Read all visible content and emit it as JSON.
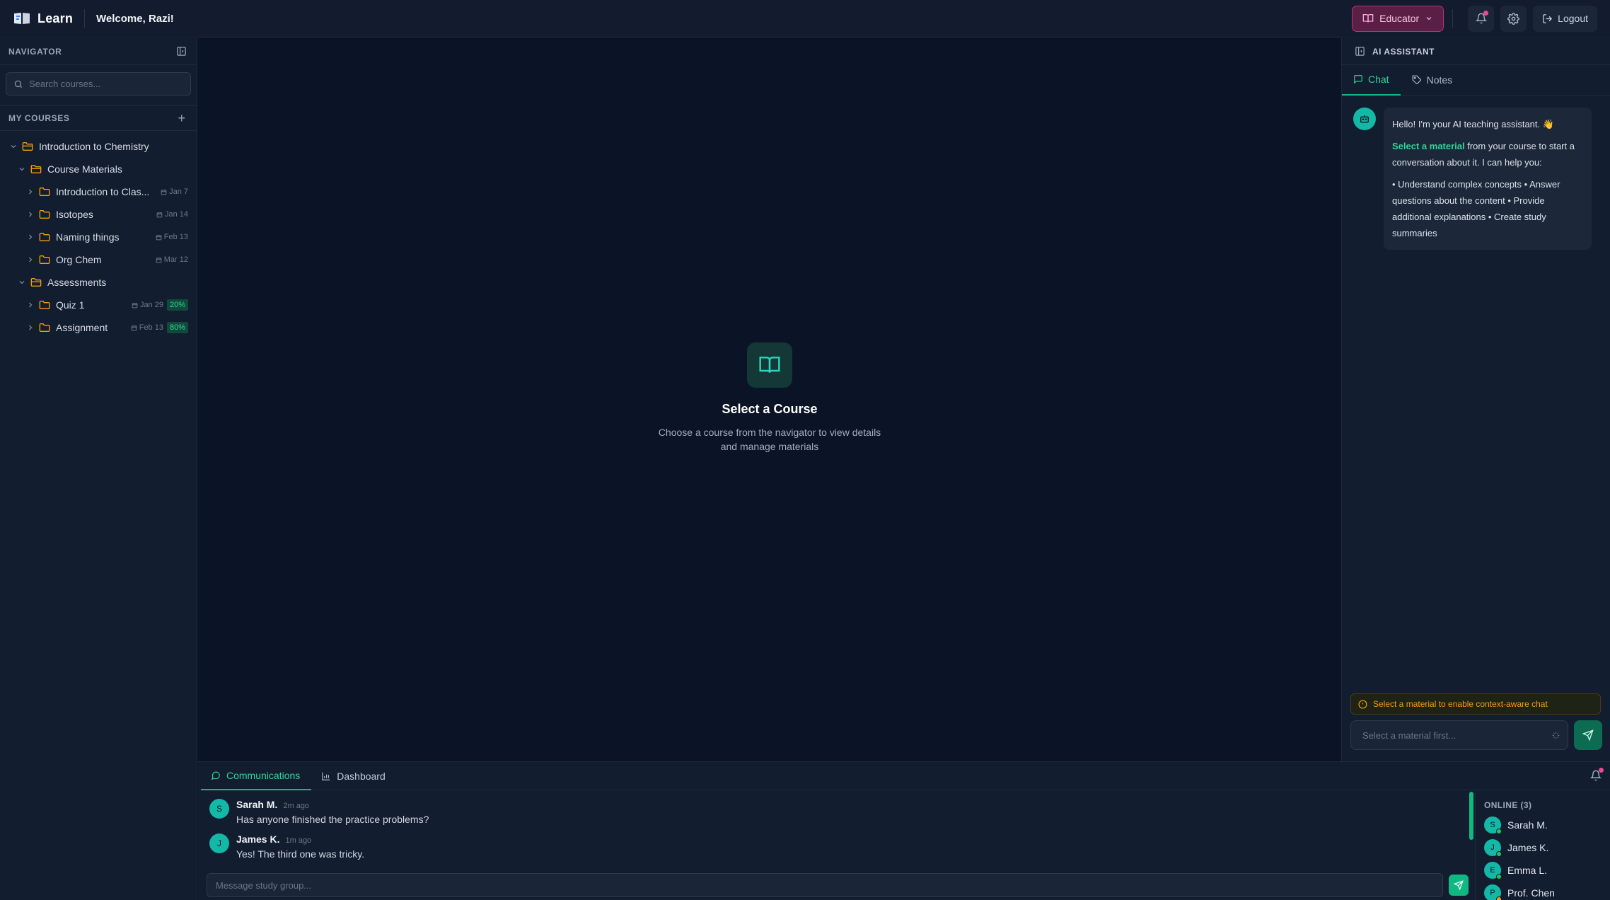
{
  "header": {
    "brand": "Learn",
    "welcome": "Welcome, Razi!",
    "role_label": "Educator",
    "logout_label": "Logout"
  },
  "navigator": {
    "title": "NAVIGATOR",
    "search_placeholder": "Search courses...",
    "my_courses_title": "MY COURSES",
    "course": "Introduction to Chemistry",
    "materials_folder": "Course Materials",
    "materials": [
      {
        "label": "Introduction to Clas...",
        "date": "Jan 7"
      },
      {
        "label": "Isotopes",
        "date": "Jan 14"
      },
      {
        "label": "Naming things",
        "date": "Feb 13"
      },
      {
        "label": "Org Chem",
        "date": "Mar 12"
      }
    ],
    "assessments_folder": "Assessments",
    "assessments": [
      {
        "label": "Quiz 1",
        "date": "Jan 29",
        "badge": "20%"
      },
      {
        "label": "Assignment",
        "date": "Feb 13",
        "badge": "80%"
      }
    ]
  },
  "main": {
    "empty_title": "Select a Course",
    "empty_text": "Choose a course from the navigator to view details and manage materials"
  },
  "assistant": {
    "title": "AI ASSISTANT",
    "tabs": [
      "Chat",
      "Notes"
    ],
    "greeting": "Hello! I'm your AI teaching assistant. 👋",
    "highlight": "Select a material",
    "intro_rest": " from your course to start a conversation about it. I can help you:",
    "capabilities": "• Understand complex concepts • Answer questions about the content • Provide additional explanations • Create study summaries",
    "warning": "Select a material to enable context-aware chat",
    "input_placeholder": "Select a material first..."
  },
  "comms": {
    "tabs": [
      "Communications",
      "Dashboard"
    ],
    "messages": [
      {
        "initial": "S",
        "author": "Sarah M.",
        "time": "2m ago",
        "text": "Has anyone finished the practice problems?"
      },
      {
        "initial": "J",
        "author": "James K.",
        "time": "1m ago",
        "text": "Yes! The third one was tricky."
      }
    ],
    "online_title": "ONLINE (3)",
    "online": [
      {
        "initial": "S",
        "name": "Sarah M."
      },
      {
        "initial": "J",
        "name": "James K."
      },
      {
        "initial": "E",
        "name": "Emma L."
      },
      {
        "initial": "P",
        "name": "Prof. Chen"
      }
    ],
    "compose_placeholder": "Message study group..."
  },
  "colors": {
    "accent": "#10b981",
    "educator": "#ec4899",
    "warning": "#f59e0b",
    "background": "#0b1426"
  },
  "icons": [
    "book-logo-icon",
    "chevron-down-icon",
    "bell-icon",
    "gear-icon",
    "logout-icon",
    "panel-icon",
    "search-icon",
    "plus-icon",
    "folder-icon",
    "calendar-icon",
    "book-open-icon",
    "chat-icon",
    "tag-icon",
    "bot-icon",
    "alert-icon",
    "sparkle-icon",
    "send-icon",
    "bar-chart-icon"
  ]
}
